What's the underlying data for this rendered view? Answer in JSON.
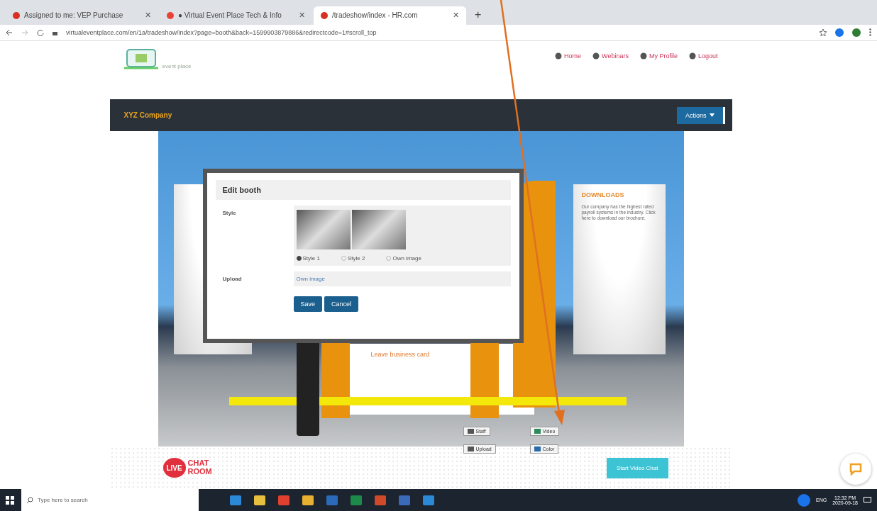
{
  "browser": {
    "tabs": [
      {
        "label": "Assigned to me: VEP Purchase",
        "selected": false
      },
      {
        "label": "● Virtual Event Place Tech & Info",
        "selected": false
      },
      {
        "label": "/tradeshow/index - HR.com",
        "selected": true
      }
    ],
    "close_glyph": "✕",
    "new_tab": "+",
    "url": "virtualeventplace.com/en/1a/tradeshow/index?page=booth&back=1599903879886&redirectcode=1#scroll_top"
  },
  "site": {
    "logo_text": "event place",
    "nav_links": [
      {
        "label": "Home"
      },
      {
        "label": "Webinars"
      },
      {
        "label": "My Profile"
      },
      {
        "label": "Logout"
      }
    ],
    "company": "XYZ Company",
    "actions_button": "Actions"
  },
  "booth": {
    "downloads_title": "DOWNLOADS",
    "downloads_text": "Our company has the highest rated payroll systems in the industry. Click here to download our brochure.",
    "business_card": "Leave business card",
    "tools": [
      {
        "label": "Staff"
      },
      {
        "label": "Video"
      },
      {
        "label": "Upload"
      },
      {
        "label": "Color"
      }
    ]
  },
  "modal": {
    "title": "Edit booth",
    "style_label": "Style",
    "style_options": [
      {
        "label": "Style 1",
        "selected": true
      },
      {
        "label": "Style 2",
        "selected": false
      },
      {
        "label": "Own image",
        "selected": false
      }
    ],
    "upload_label": "Upload",
    "upload_link": "Own image",
    "buttons": [
      "Save",
      "Cancel"
    ]
  },
  "footer": {
    "live_badge": "LIVE",
    "chat_label": "CHAT ROOM",
    "start_chat": "Start Video Chat"
  },
  "taskbar": {
    "search_placeholder": "Type here to search",
    "language": "ENG",
    "time": "12:32 PM",
    "date": "2020-09-18"
  }
}
